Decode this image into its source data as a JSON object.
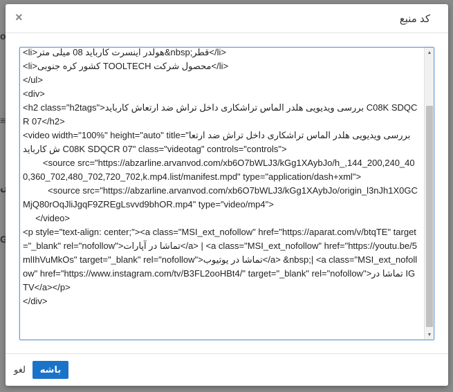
{
  "dialog": {
    "title": "کد منبع",
    "close_label": "×",
    "ok_label": "باشه",
    "cancel_label": "لغو"
  },
  "editor": {
    "lines": [
      "<li>هولدر اینسرت کارباید 08 میلی متر&nbsp;قطر</li>",
      "<li>کشور کره جنوبی TOOLTECH محصول شرکت</li>",
      "</ul>",
      "<div>",
      "<h2 class=\"h2tags\">بررسی ویدیویی هلدر الماس تراشکاری داخل تراش ضد ارتعاش کارباید C08K SDQCR 07</h2>",
      "<video width=\"100%\" height=\"auto\" title=\"بررسی ویدیویی هلدر الماس تراشکاری داخل تراش ضد ارتعاش کارباید C08K SDQCR 07\" class=\"videotag\" controls=\"controls\">",
      "        <source src=\"https://abzarline.arvanvod.com/xb6O7bWLJ3/kGg1XAybJo/h_,144_200,240_400,360_702,480_702,720_702,k.mp4.list/manifest.mpd\" type=\"application/dash+xml\">",
      "          <source src=\"https://abzarline.arvanvod.com/xb6O7bWLJ3/kGg1XAybJo/origin_l3nJh1X0GCMjQ80rOqJliJgqF9ZREgLsvvd9bhOR.mp4\" type=\"video/mp4\">",
      "     </video>",
      "<p style=\"text-align: center;\"><a class=\"MSI_ext_nofollow\" href=\"https://aparat.com/v/btqTE\" target=\"_blank\" rel=\"nofollow\">تماشا در آپارات</a> | <a class=\"MSI_ext_nofollow\" href=\"https://youtu.be/5mlIhVuMkOs\" target=\"_blank\" rel=\"nofollow\">تماشا در یوتیوب</a> &nbsp;| <a class=\"MSI_ext_nofollow\" href=\"https://www.instagram.com/tv/B3FL2ooHBt4/\" target=\"_blank\" rel=\"nofollow\">تماشا در IGTV</a></p>",
      "</div>"
    ]
  },
  "icons": {
    "close": "close-icon",
    "scroll_up": "scroll-up-arrow-icon",
    "scroll_down": "scroll-down-arrow-icon"
  },
  "colors": {
    "primary_button": "#1a73c9",
    "editor_border": "#6a9bd6",
    "overlay": "#7f7f7f"
  }
}
